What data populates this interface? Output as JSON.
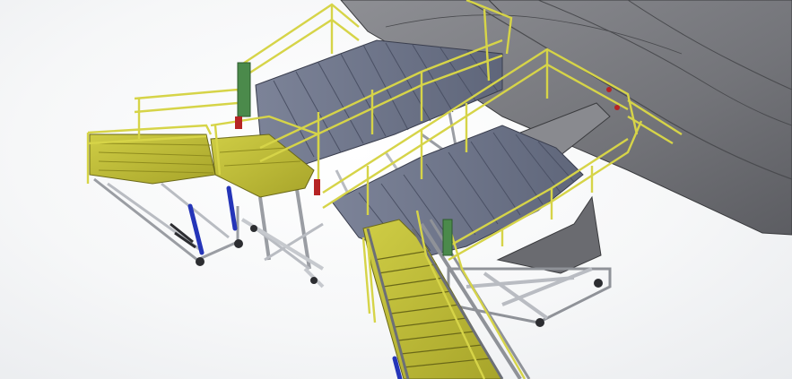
{
  "model": {
    "colors": {
      "background": "#f4f5f6",
      "wing_skin": "#7d7e83",
      "wing_skin_dark": "#5f6064",
      "deck_plate": "#6d7488",
      "deck_plate_light": "#8a90a4",
      "walkway_yellow": "#c4c23a",
      "walkway_yellow_dark": "#8f8c1e",
      "rail_yellow": "#d6d448",
      "frame_grey": "#b9bcc2",
      "frame_dark": "#6c6f76",
      "hydraulic_blue": "#2535b8",
      "tank_green": "#4b8a4b",
      "accent_red": "#b62424",
      "wheel_dark": "#2c2d31"
    }
  }
}
